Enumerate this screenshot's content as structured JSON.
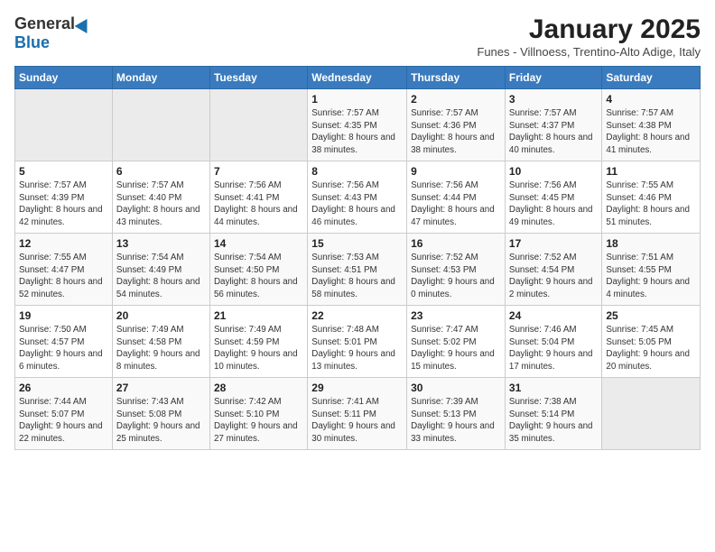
{
  "header": {
    "logo_general": "General",
    "logo_blue": "Blue",
    "title": "January 2025",
    "subtitle": "Funes - Villnoess, Trentino-Alto Adige, Italy"
  },
  "days_of_week": [
    "Sunday",
    "Monday",
    "Tuesday",
    "Wednesday",
    "Thursday",
    "Friday",
    "Saturday"
  ],
  "weeks": [
    [
      {
        "day": "",
        "sunrise": "",
        "sunset": "",
        "daylight": ""
      },
      {
        "day": "",
        "sunrise": "",
        "sunset": "",
        "daylight": ""
      },
      {
        "day": "",
        "sunrise": "",
        "sunset": "",
        "daylight": ""
      },
      {
        "day": "1",
        "sunrise": "Sunrise: 7:57 AM",
        "sunset": "Sunset: 4:35 PM",
        "daylight": "Daylight: 8 hours and 38 minutes."
      },
      {
        "day": "2",
        "sunrise": "Sunrise: 7:57 AM",
        "sunset": "Sunset: 4:36 PM",
        "daylight": "Daylight: 8 hours and 38 minutes."
      },
      {
        "day": "3",
        "sunrise": "Sunrise: 7:57 AM",
        "sunset": "Sunset: 4:37 PM",
        "daylight": "Daylight: 8 hours and 40 minutes."
      },
      {
        "day": "4",
        "sunrise": "Sunrise: 7:57 AM",
        "sunset": "Sunset: 4:38 PM",
        "daylight": "Daylight: 8 hours and 41 minutes."
      }
    ],
    [
      {
        "day": "5",
        "sunrise": "Sunrise: 7:57 AM",
        "sunset": "Sunset: 4:39 PM",
        "daylight": "Daylight: 8 hours and 42 minutes."
      },
      {
        "day": "6",
        "sunrise": "Sunrise: 7:57 AM",
        "sunset": "Sunset: 4:40 PM",
        "daylight": "Daylight: 8 hours and 43 minutes."
      },
      {
        "day": "7",
        "sunrise": "Sunrise: 7:56 AM",
        "sunset": "Sunset: 4:41 PM",
        "daylight": "Daylight: 8 hours and 44 minutes."
      },
      {
        "day": "8",
        "sunrise": "Sunrise: 7:56 AM",
        "sunset": "Sunset: 4:43 PM",
        "daylight": "Daylight: 8 hours and 46 minutes."
      },
      {
        "day": "9",
        "sunrise": "Sunrise: 7:56 AM",
        "sunset": "Sunset: 4:44 PM",
        "daylight": "Daylight: 8 hours and 47 minutes."
      },
      {
        "day": "10",
        "sunrise": "Sunrise: 7:56 AM",
        "sunset": "Sunset: 4:45 PM",
        "daylight": "Daylight: 8 hours and 49 minutes."
      },
      {
        "day": "11",
        "sunrise": "Sunrise: 7:55 AM",
        "sunset": "Sunset: 4:46 PM",
        "daylight": "Daylight: 8 hours and 51 minutes."
      }
    ],
    [
      {
        "day": "12",
        "sunrise": "Sunrise: 7:55 AM",
        "sunset": "Sunset: 4:47 PM",
        "daylight": "Daylight: 8 hours and 52 minutes."
      },
      {
        "day": "13",
        "sunrise": "Sunrise: 7:54 AM",
        "sunset": "Sunset: 4:49 PM",
        "daylight": "Daylight: 8 hours and 54 minutes."
      },
      {
        "day": "14",
        "sunrise": "Sunrise: 7:54 AM",
        "sunset": "Sunset: 4:50 PM",
        "daylight": "Daylight: 8 hours and 56 minutes."
      },
      {
        "day": "15",
        "sunrise": "Sunrise: 7:53 AM",
        "sunset": "Sunset: 4:51 PM",
        "daylight": "Daylight: 8 hours and 58 minutes."
      },
      {
        "day": "16",
        "sunrise": "Sunrise: 7:52 AM",
        "sunset": "Sunset: 4:53 PM",
        "daylight": "Daylight: 9 hours and 0 minutes."
      },
      {
        "day": "17",
        "sunrise": "Sunrise: 7:52 AM",
        "sunset": "Sunset: 4:54 PM",
        "daylight": "Daylight: 9 hours and 2 minutes."
      },
      {
        "day": "18",
        "sunrise": "Sunrise: 7:51 AM",
        "sunset": "Sunset: 4:55 PM",
        "daylight": "Daylight: 9 hours and 4 minutes."
      }
    ],
    [
      {
        "day": "19",
        "sunrise": "Sunrise: 7:50 AM",
        "sunset": "Sunset: 4:57 PM",
        "daylight": "Daylight: 9 hours and 6 minutes."
      },
      {
        "day": "20",
        "sunrise": "Sunrise: 7:49 AM",
        "sunset": "Sunset: 4:58 PM",
        "daylight": "Daylight: 9 hours and 8 minutes."
      },
      {
        "day": "21",
        "sunrise": "Sunrise: 7:49 AM",
        "sunset": "Sunset: 4:59 PM",
        "daylight": "Daylight: 9 hours and 10 minutes."
      },
      {
        "day": "22",
        "sunrise": "Sunrise: 7:48 AM",
        "sunset": "Sunset: 5:01 PM",
        "daylight": "Daylight: 9 hours and 13 minutes."
      },
      {
        "day": "23",
        "sunrise": "Sunrise: 7:47 AM",
        "sunset": "Sunset: 5:02 PM",
        "daylight": "Daylight: 9 hours and 15 minutes."
      },
      {
        "day": "24",
        "sunrise": "Sunrise: 7:46 AM",
        "sunset": "Sunset: 5:04 PM",
        "daylight": "Daylight: 9 hours and 17 minutes."
      },
      {
        "day": "25",
        "sunrise": "Sunrise: 7:45 AM",
        "sunset": "Sunset: 5:05 PM",
        "daylight": "Daylight: 9 hours and 20 minutes."
      }
    ],
    [
      {
        "day": "26",
        "sunrise": "Sunrise: 7:44 AM",
        "sunset": "Sunset: 5:07 PM",
        "daylight": "Daylight: 9 hours and 22 minutes."
      },
      {
        "day": "27",
        "sunrise": "Sunrise: 7:43 AM",
        "sunset": "Sunset: 5:08 PM",
        "daylight": "Daylight: 9 hours and 25 minutes."
      },
      {
        "day": "28",
        "sunrise": "Sunrise: 7:42 AM",
        "sunset": "Sunset: 5:10 PM",
        "daylight": "Daylight: 9 hours and 27 minutes."
      },
      {
        "day": "29",
        "sunrise": "Sunrise: 7:41 AM",
        "sunset": "Sunset: 5:11 PM",
        "daylight": "Daylight: 9 hours and 30 minutes."
      },
      {
        "day": "30",
        "sunrise": "Sunrise: 7:39 AM",
        "sunset": "Sunset: 5:13 PM",
        "daylight": "Daylight: 9 hours and 33 minutes."
      },
      {
        "day": "31",
        "sunrise": "Sunrise: 7:38 AM",
        "sunset": "Sunset: 5:14 PM",
        "daylight": "Daylight: 9 hours and 35 minutes."
      },
      {
        "day": "",
        "sunrise": "",
        "sunset": "",
        "daylight": ""
      }
    ]
  ]
}
